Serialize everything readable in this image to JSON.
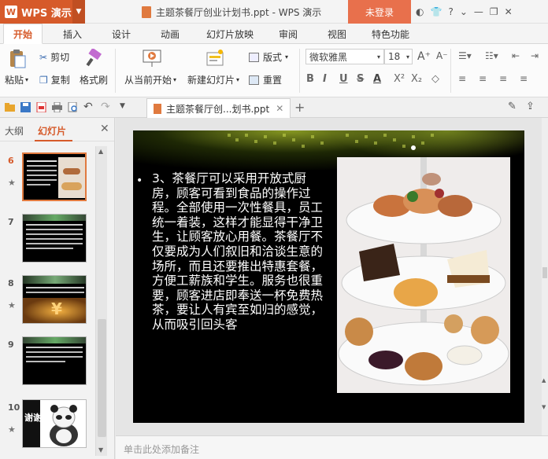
{
  "app": {
    "name": "WPS 演示",
    "logo_letter": "W",
    "document_title": "主题茶餐厅创业计划书.ppt - WPS 演示",
    "login_label": "未登录"
  },
  "menu": {
    "tabs": [
      "开始",
      "插入",
      "设计",
      "动画",
      "幻灯片放映",
      "审阅",
      "视图",
      "特色功能"
    ],
    "active": 0
  },
  "ribbon": {
    "paste": "粘贴",
    "cut": "剪切",
    "copy": "复制",
    "format_painter": "格式刷",
    "from_current": "从当前开始",
    "new_slide": "新建幻灯片",
    "layout": "版式",
    "reset": "重置",
    "font_name": "微软雅黑",
    "font_size": "18"
  },
  "doc_tab": {
    "label": "主题茶餐厅创...划书.ppt"
  },
  "left_panel": {
    "tab_outline": "大纲",
    "tab_slides": "幻灯片",
    "thumbnails": [
      {
        "num": "6",
        "active": true
      },
      {
        "num": "7",
        "active": false
      },
      {
        "num": "8",
        "active": false
      },
      {
        "num": "9",
        "active": false
      },
      {
        "num": "10",
        "active": false,
        "text": "谢谢！"
      }
    ]
  },
  "slide": {
    "bullet": "•",
    "body": "3、茶餐厅可以采用开放式厨房，顾客可看到食品的操作过程。全部使用一次性餐具，员工统一着装，这样才能显得干净卫生，让顾客放心用餐。茶餐厅不仅要成为人们叙旧和洽谈生意的场所，而且还要推出特惠套餐，方便工薪族和学生。服务也很重要，顾客进店即奉送一杯免费热茶，要让人有宾至如归的感觉，从而吸引回头客"
  },
  "notes": {
    "placeholder": "单击此处添加备注"
  },
  "colors": {
    "accent": "#d65a2a",
    "login": "#e8704c"
  }
}
